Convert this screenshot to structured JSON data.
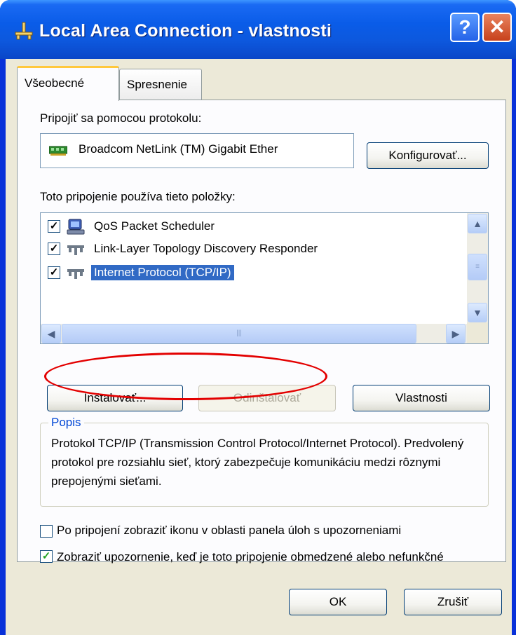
{
  "window": {
    "title": "Local Area Connection - vlastnosti",
    "help_label": "?",
    "close_label": "✕",
    "colors": {
      "titlebar": "#0a5ce8",
      "accent_tab": "#ffc83c",
      "selection": "#316ac5",
      "annotation": "#e30000"
    }
  },
  "tabs": [
    {
      "label": "Všeobecné",
      "selected": true
    },
    {
      "label": "Spresnenie",
      "selected": false
    }
  ],
  "connect_using": {
    "label": "Pripojiť sa pomocou protokolu:",
    "adapter": "Broadcom NetLink (TM) Gigabit Ether",
    "configure_label": "Konfigurovať..."
  },
  "components": {
    "label": "Toto pripojenie používa tieto položky:",
    "items": [
      {
        "label": "QoS Packet Scheduler",
        "checked": true,
        "icon": "scheduler-icon"
      },
      {
        "label": "Link-Layer Topology Discovery Responder",
        "checked": true,
        "icon": "protocol-icon"
      },
      {
        "label": "Internet Protocol (TCP/IP)",
        "checked": true,
        "selected": true,
        "icon": "protocol-icon"
      }
    ]
  },
  "buttons": {
    "install": "Inštalovať...",
    "uninstall": "Odinštalovať",
    "properties": "Vlastnosti",
    "ok": "OK",
    "cancel": "Zrušiť"
  },
  "description": {
    "title": "Popis",
    "text": "Protokol TCP/IP (Transmission Control Protocol/Internet Protocol). Predvolený protokol pre rozsiahlu sieť, ktorý zabezpečuje komunikáciu medzi rôznymi prepojenými sieťami."
  },
  "options": [
    {
      "label": "Po pripojení zobraziť ikonu v oblasti panela úloh s upozorneniami",
      "checked": false
    },
    {
      "label": "Zobraziť upozornenie, keď je toto pripojenie obmedzené alebo nefunkčné",
      "checked": true
    }
  ],
  "check_mark": "✓"
}
